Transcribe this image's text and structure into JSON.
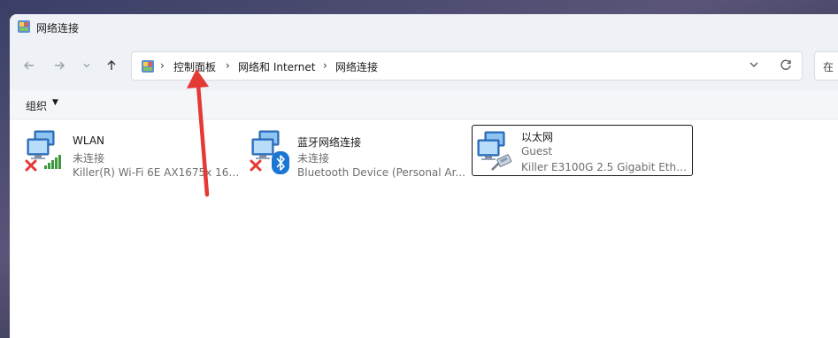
{
  "window": {
    "title": "网络连接"
  },
  "nav": {
    "back_icon": "arrow-left-icon",
    "forward_icon": "arrow-right-icon",
    "recent_icon": "chevron-down-icon",
    "up_icon": "arrow-up-icon"
  },
  "address": {
    "breadcrumbs": [
      "控制面板",
      "网络和 Internet",
      "网络连接"
    ],
    "separator": "›"
  },
  "search": {
    "placeholder": "在"
  },
  "toolbar": {
    "organize_label": "组织"
  },
  "connections": [
    {
      "name": "WLAN",
      "status": "未连接",
      "device": "Killer(R) Wi-Fi 6E AX1675x 160...",
      "badge": "disconnected-x-icon",
      "overlay": "wifi-signal-icon"
    },
    {
      "name": "蓝牙网络连接",
      "status": "未连接",
      "device": "Bluetooth Device (Personal Ar...",
      "badge": "disconnected-x-icon",
      "overlay": "bluetooth-icon"
    },
    {
      "name": "以太网",
      "status": "Guest",
      "device": "Killer E3100G 2.5 Gigabit Ether...",
      "badge": "",
      "overlay": "ethernet-cable-icon"
    }
  ],
  "colors": {
    "accent_red": "#e53935",
    "bluetooth_blue": "#1976d2",
    "signal_green": "#3c9a3c"
  }
}
